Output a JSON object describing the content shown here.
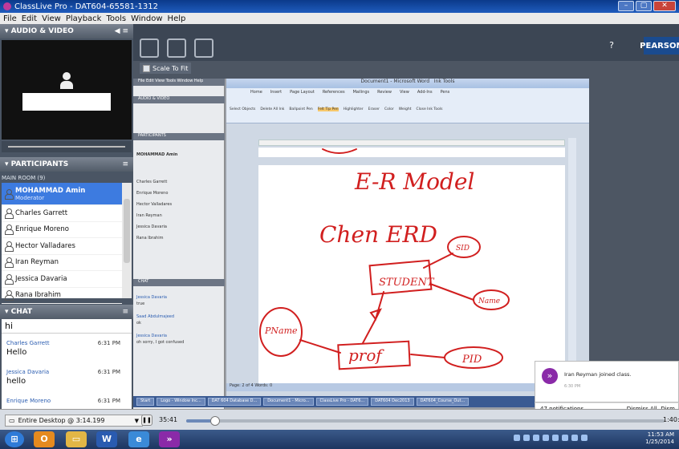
{
  "window": {
    "title": "ClassLive Pro - DAT604-65581-1312"
  },
  "menu": [
    "File",
    "Edit",
    "View",
    "Playback",
    "Tools",
    "Window",
    "Help"
  ],
  "audio_video": {
    "header": "AUDIO & VIDEO"
  },
  "participants": {
    "header": "PARTICIPANTS",
    "room": "MAIN ROOM (9)",
    "items": [
      {
        "name": "MOHAMMAD Amin",
        "role": "Moderator"
      },
      {
        "name": "Charles Garrett"
      },
      {
        "name": "Enrique Moreno"
      },
      {
        "name": "Hector Valladares"
      },
      {
        "name": "Iran Reyman"
      },
      {
        "name": "Jessica Davaria"
      },
      {
        "name": "Rana Ibrahim"
      }
    ]
  },
  "chat": {
    "header": "CHAT",
    "input": "hi",
    "messages": [
      {
        "sender": "Charles Garrett",
        "time": "6:31 PM",
        "text": "Hello"
      },
      {
        "sender": "Jessica Davaria",
        "time": "6:31 PM",
        "text": "hello"
      },
      {
        "sender": "Enrique Moreno",
        "time": "6:31 PM"
      }
    ]
  },
  "toolbar": {
    "scale_label": "Scale To Fit",
    "help": "?"
  },
  "brand": {
    "label": "PEARSON",
    "color": "#1a4b8f"
  },
  "shared_screen": {
    "inner_title": "Document1 - Microsoft Word",
    "inner_tab": "Ink Tools",
    "inner_menu": "File  Edit  View  Tools  Window  Help",
    "inner_headers": [
      "AUDIO & VIDEO",
      "PARTICIPANTS",
      "CHAT"
    ],
    "inner_participants": [
      "MOHAMMAD Amin",
      "Charles Garrett",
      "Enrique Moreno",
      "Hector Valladares",
      "Iran Reyman",
      "Jessica Davaria",
      "Rana Ibrahim"
    ],
    "inner_chat": [
      {
        "sender": "Jessica Davaria",
        "text": "true"
      },
      {
        "sender": "Saad Abdulmajeed",
        "text": "ok"
      },
      {
        "sender": "Jessica Davaria",
        "text": "oh sorry, I got confused"
      }
    ],
    "ribbon_tabs": [
      "Home",
      "Insert",
      "Page Layout",
      "References",
      "Mailings",
      "Review",
      "View",
      "Add-Ins",
      "Pens"
    ],
    "ribbon_tools": [
      "Select Objects",
      "Delete All Ink",
      "Ballpoint Pen",
      "Felt Tip Pen",
      "Highlighter",
      "Eraser",
      "Color",
      "Weight",
      "Close Ink Tools"
    ],
    "status": "Page: 2 of 4   Words: 0",
    "taskbar_items": [
      "Start",
      "Logo - Window Inc...",
      "DAT 604 Database D...",
      "Document1 - Micro...",
      "ClassLive Pro - DAT6...",
      "DAT604 Dec2013",
      "DAT604_Course_Out..."
    ],
    "handwriting": {
      "title": "E-R Model",
      "subtitle": "Chen ERD",
      "entity1": "STUDENT",
      "entity2": "prof",
      "attr1": "SID",
      "attr2": "Name",
      "attr3": "PID",
      "attr4": "PName"
    }
  },
  "notification": {
    "text": "Iran Reyman joined class.",
    "time": "6:30 PM",
    "count": "47 notifications",
    "dismiss": "Dismiss All",
    "dismiss_more": "Dism"
  },
  "playback": {
    "source": "Entire Desktop @ 3:14.199",
    "elapsed": "35:41",
    "remaining": "1:40:",
    "progress": 0.06
  },
  "taskbar": {
    "time": "11:53 AM",
    "date": "1/25/2014"
  }
}
